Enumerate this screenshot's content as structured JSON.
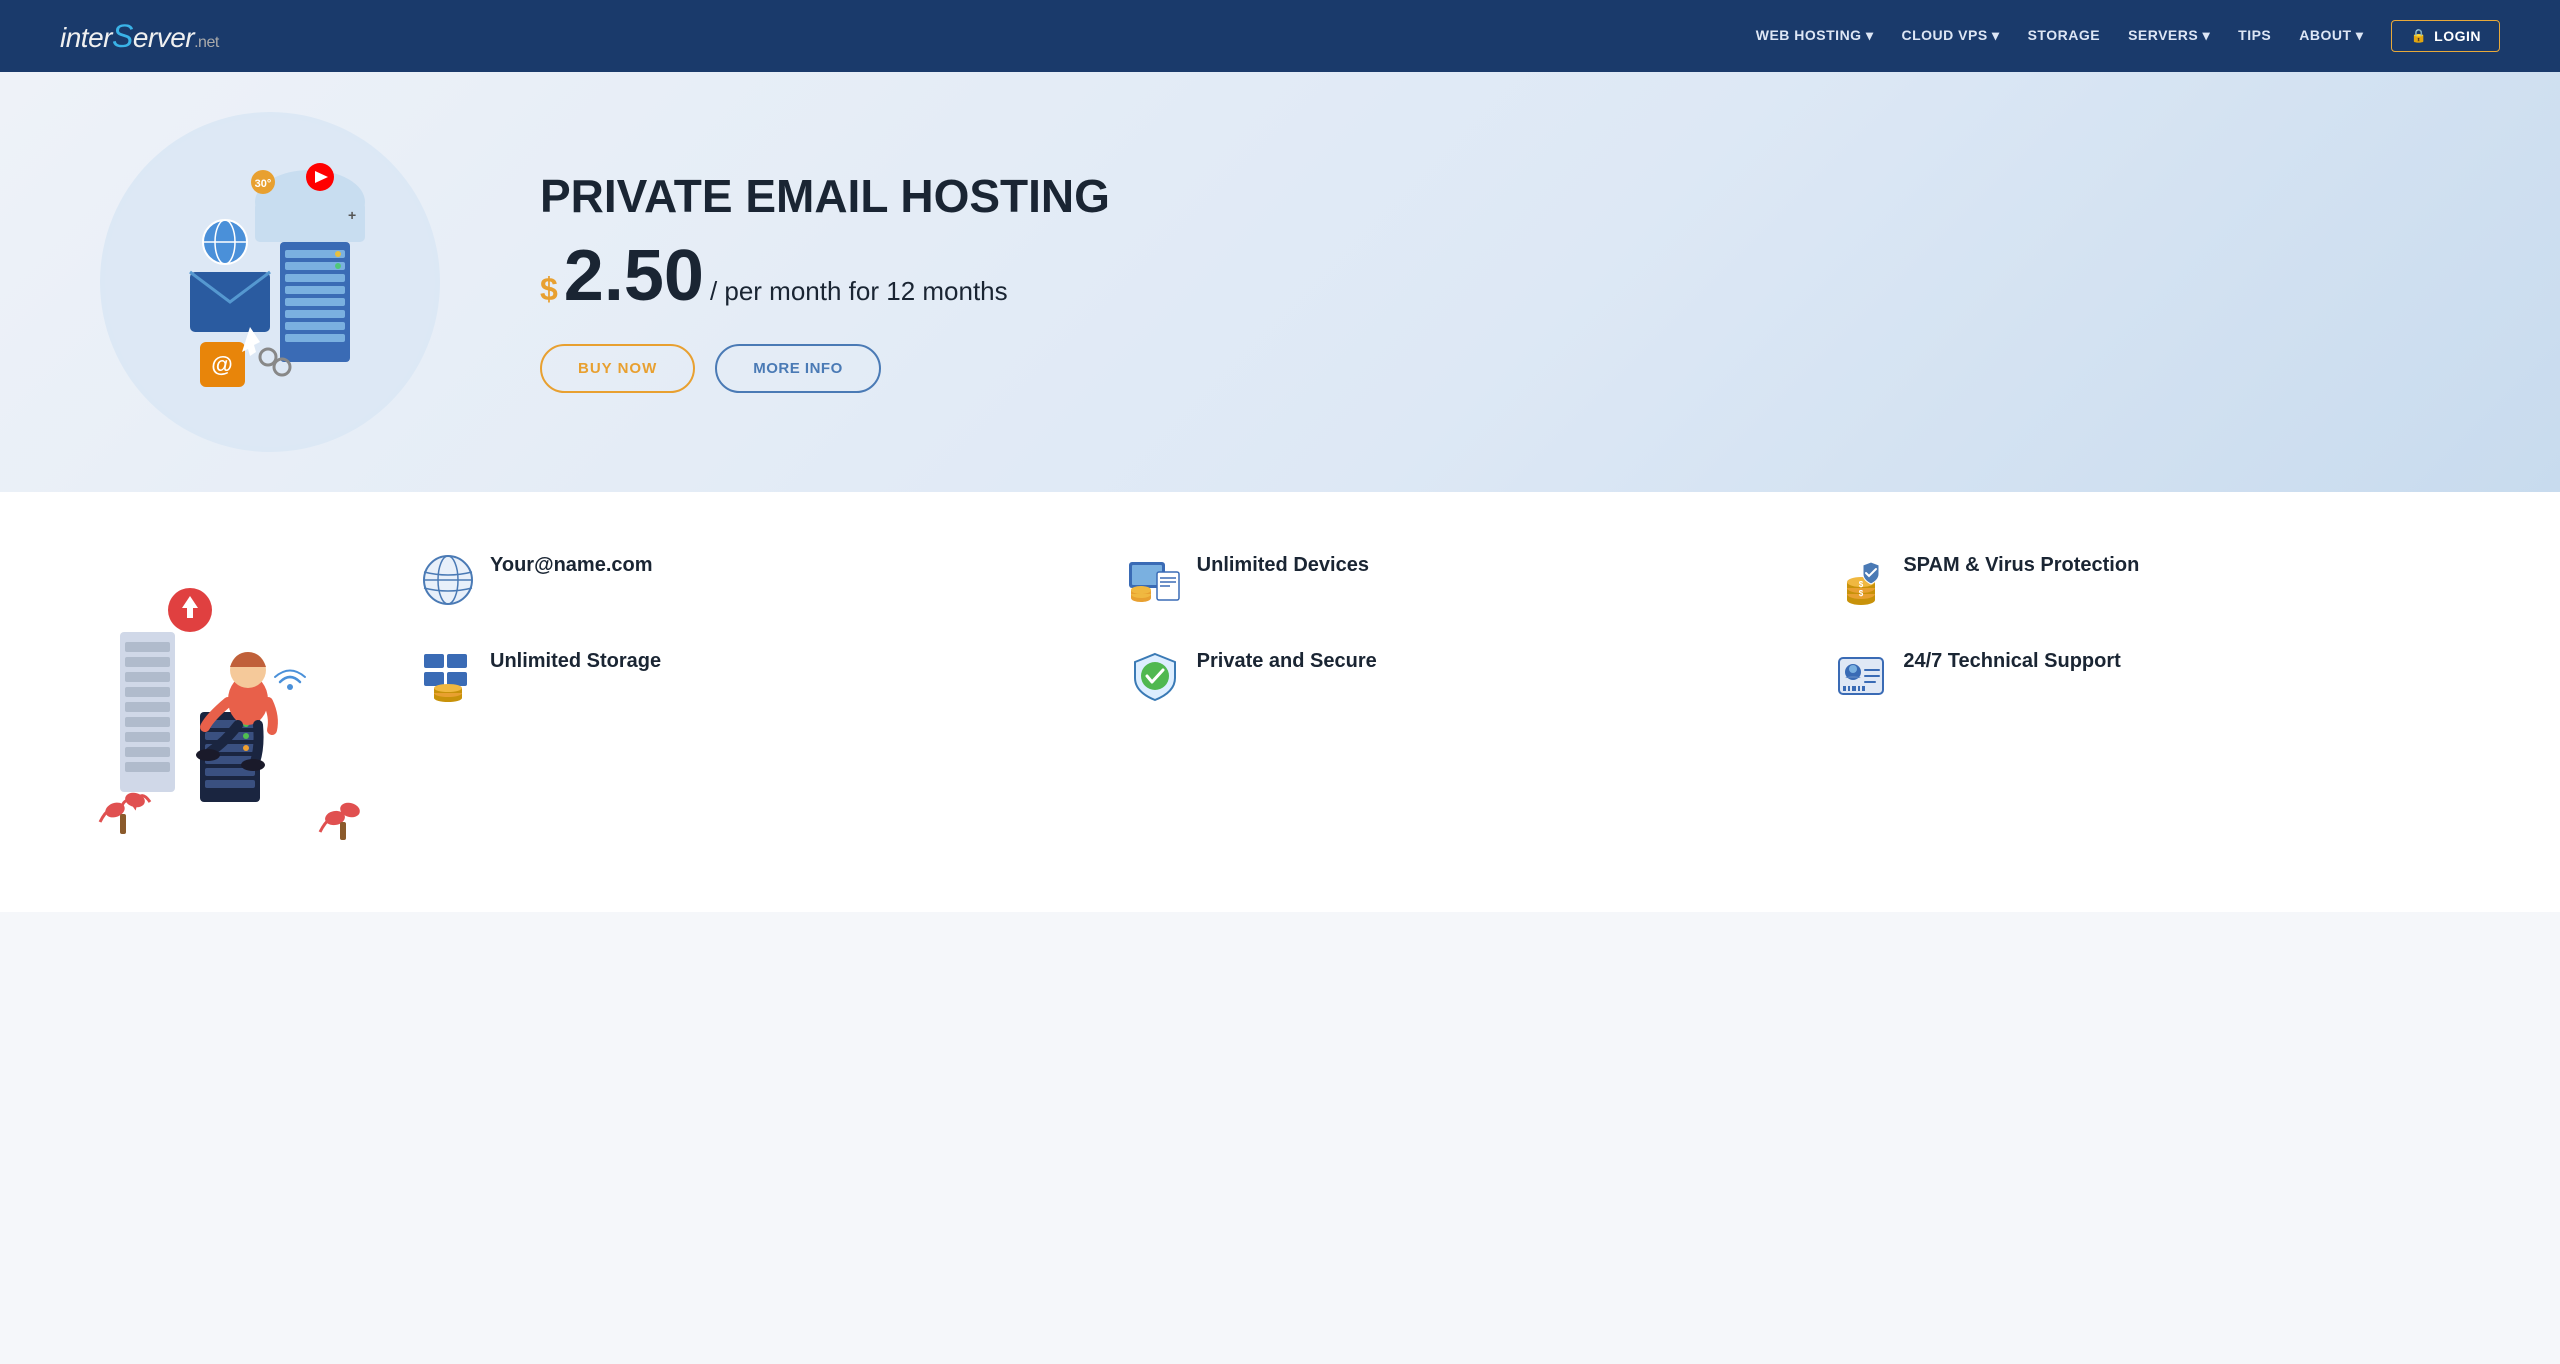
{
  "nav": {
    "logo": {
      "inter": "inter",
      "s": "S",
      "erver": "erver",
      "dotnet": ".net"
    },
    "links": [
      {
        "label": "WEB HOSTING",
        "hasDropdown": true
      },
      {
        "label": "CLOUD VPS",
        "hasDropdown": true
      },
      {
        "label": "STORAGE",
        "hasDropdown": false
      },
      {
        "label": "SERVERS",
        "hasDropdown": true
      },
      {
        "label": "TIPS",
        "hasDropdown": false
      },
      {
        "label": "ABOUT",
        "hasDropdown": true
      }
    ],
    "login_label": "LOGIN"
  },
  "hero": {
    "title": "PRIVATE EMAIL HOSTING",
    "price_dollar": "$",
    "price_amount": "2.50",
    "price_suffix": "/ per month for 12 months",
    "btn_buy": "BUY NOW",
    "btn_info": "MORE INFO"
  },
  "features": {
    "items": [
      {
        "id": "your-email",
        "label": "Your@name.com",
        "icon": "🌐"
      },
      {
        "id": "unlimited-devices",
        "label": "Unlimited Devices",
        "icon": "💻"
      },
      {
        "id": "spam-virus",
        "label": "SPAM & Virus Protection",
        "icon": "🛡️"
      },
      {
        "id": "unlimited-storage",
        "label": "Unlimited Storage",
        "icon": "🗄️"
      },
      {
        "id": "private-secure",
        "label": "Private and Secure",
        "icon": "🔒"
      },
      {
        "id": "support",
        "label": "24/7 Technical Support",
        "icon": "🎧"
      }
    ]
  }
}
